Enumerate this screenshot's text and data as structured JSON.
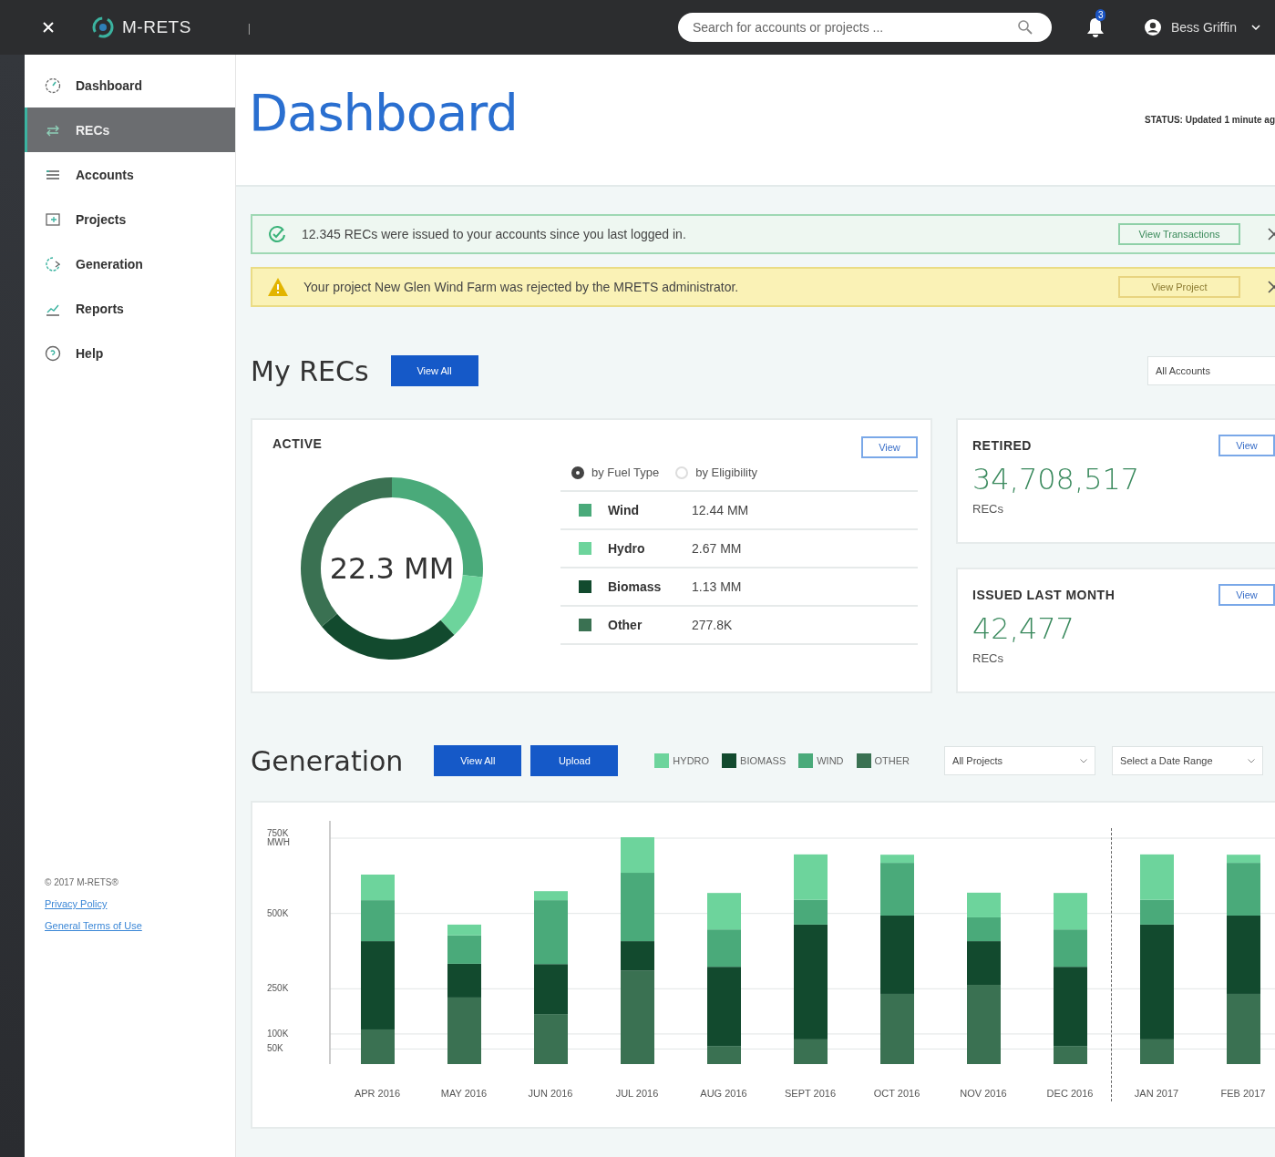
{
  "header": {
    "brand": "M-RETS",
    "separator": "|",
    "search": {
      "placeholder": "Search for accounts or projects ..."
    },
    "notifications": "3",
    "user": "Bess Griffin"
  },
  "sidebar": {
    "items": [
      {
        "label": "Dashboard",
        "selected": false
      },
      {
        "label": "RECs",
        "selected": true
      },
      {
        "label": "Accounts",
        "selected": false
      },
      {
        "label": "Projects",
        "selected": false
      },
      {
        "label": "Generation",
        "selected": false
      },
      {
        "label": "Reports",
        "selected": false
      },
      {
        "label": "Help",
        "selected": false
      }
    ],
    "copyright": "© 2017 M-RETS®",
    "links": [
      "Privacy Policy",
      "General Terms of Use"
    ]
  },
  "page": {
    "title": "Dashboard",
    "status": "STATUS: Updated 1 minute ag"
  },
  "alerts": [
    {
      "kind": "success",
      "text": "12.345 RECs were issued to your accounts since you last logged in.",
      "action": "View Transactions"
    },
    {
      "kind": "warning",
      "text": "Your project New Glen Wind Farm was rejected by the MRETS administrator.",
      "action": "View Project"
    }
  ],
  "my_recs": {
    "title": "My RECs",
    "button": "View All",
    "filter": "All Accounts",
    "active": {
      "title": "ACTIVE",
      "button": "View",
      "total": "22.3 MM",
      "options": [
        {
          "label": "by Fuel Type",
          "selected": true
        },
        {
          "label": "by Eligibility",
          "selected": false
        }
      ],
      "rows": [
        {
          "name": "Wind",
          "value": "12.44 MM",
          "color": "#4aaa7a"
        },
        {
          "name": "Hydro",
          "value": "2.67 MM",
          "color": "#6dd49c"
        },
        {
          "name": "Biomass",
          "value": "1.13 MM",
          "color": "#124a2e"
        },
        {
          "name": "Other",
          "value": "277.8K",
          "color": "#3a7152"
        }
      ]
    },
    "cards": [
      {
        "title": "RETIRED",
        "button": "View",
        "value": "34,708,517",
        "unit": "RECs"
      },
      {
        "title": "ISSUED LAST MONTH",
        "button": "View",
        "value": "42,477",
        "unit": "RECs"
      }
    ]
  },
  "generation": {
    "title": "Generation",
    "buttons": [
      "View All",
      "Upload"
    ],
    "filters": [
      "All Projects",
      "Select a Date Range"
    ],
    "chart_data": {
      "type": "bar",
      "stacked": true,
      "categories": [
        "APR 2016",
        "MAY 2016",
        "JUN 2016",
        "JUL 2016",
        "AUG 2016",
        "SEPT 2016",
        "OCT 2016",
        "NOV 2016",
        "DEC 2016",
        "JAN 2017",
        "FEB 2017"
      ],
      "series": [
        {
          "name": "HYDRO",
          "color": "#6dd49c",
          "values": [
            85000,
            36000,
            30000,
            118000,
            121000,
            151000,
            27000,
            82000,
            121000,
            151000,
            27000
          ]
        },
        {
          "name": "BIOMASS",
          "color": "#124a2e",
          "values": [
            293000,
            112000,
            166000,
            97000,
            263000,
            381000,
            260000,
            145000,
            263000,
            381000,
            260000
          ]
        },
        {
          "name": "WIND",
          "color": "#4aaa7a",
          "values": [
            136000,
            94000,
            212000,
            227000,
            124000,
            82000,
            175000,
            79000,
            124000,
            82000,
            175000
          ]
        },
        {
          "name": "OTHER",
          "color": "#3a7152",
          "values": [
            115000,
            221000,
            166000,
            311000,
            60000,
            82000,
            233000,
            263000,
            60000,
            82000,
            233000
          ]
        }
      ],
      "grid": true,
      "ylim": [
        0,
        750000
      ],
      "yticks": [
        {
          "value": 50000,
          "label": "50K"
        },
        {
          "value": 100000,
          "label": "100K"
        },
        {
          "value": 250000,
          "label": "250K"
        },
        {
          "value": 500000,
          "label": "500K"
        },
        {
          "value": 750000,
          "label": "750K MWH"
        }
      ]
    }
  }
}
